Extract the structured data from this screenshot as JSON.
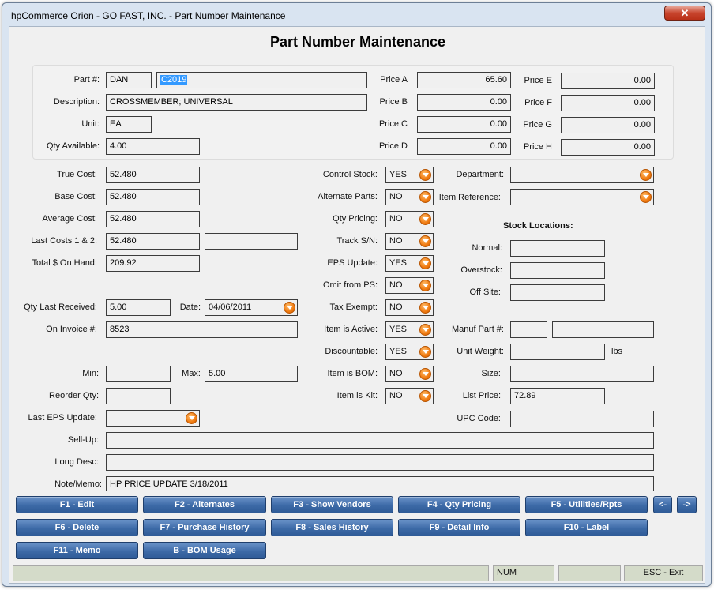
{
  "window": {
    "title": "hpCommerce Orion - GO FAST, INC. - Part Number Maintenance",
    "close_glyph": "✕"
  },
  "form": {
    "title": "Part Number Maintenance"
  },
  "header": {
    "part_label": "Part #:",
    "part_prefix": "DAN",
    "part_number": "C2019",
    "description_label": "Description:",
    "description": "CROSSMEMBER; UNIVERSAL",
    "unit_label": "Unit:",
    "unit": "EA",
    "qty_available_label": "Qty Available:",
    "qty_available": "4.00",
    "prices": [
      {
        "label": "Price A",
        "value": "65.60"
      },
      {
        "label": "Price B",
        "value": "0.00"
      },
      {
        "label": "Price C",
        "value": "0.00"
      },
      {
        "label": "Price D",
        "value": "0.00"
      },
      {
        "label": "Price E",
        "value": "0.00"
      },
      {
        "label": "Price F",
        "value": "0.00"
      },
      {
        "label": "Price G",
        "value": "0.00"
      },
      {
        "label": "Price H",
        "value": "0.00"
      }
    ]
  },
  "costs": {
    "true_cost_label": "True Cost:",
    "true_cost": "52.480",
    "base_cost_label": "Base Cost:",
    "base_cost": "52.480",
    "average_cost_label": "Average Cost:",
    "average_cost": "52.480",
    "last_costs_label": "Last Costs 1 & 2:",
    "last_cost_1": "52.480",
    "last_cost_2": "",
    "total_on_hand_label": "Total $ On Hand:",
    "total_on_hand": "209.92",
    "qty_last_received_label": "Qty Last Received:",
    "qty_last_received": "5.00",
    "date_label": "Date:",
    "date": "04/06/2011",
    "on_invoice_label": "On Invoice #:",
    "on_invoice": "8523",
    "min_label": "Min:",
    "min": "",
    "max_label": "Max:",
    "max": "5.00",
    "reorder_qty_label": "Reorder Qty:",
    "reorder_qty": "",
    "last_eps_update_label": "Last EPS Update:",
    "last_eps_update": ""
  },
  "flags": [
    {
      "label": "Control Stock:",
      "value": "YES"
    },
    {
      "label": "Alternate Parts:",
      "value": "NO"
    },
    {
      "label": "Qty Pricing:",
      "value": "NO"
    },
    {
      "label": "Track S/N:",
      "value": "NO"
    },
    {
      "label": "EPS Update:",
      "value": "YES"
    },
    {
      "label": "Omit from PS:",
      "value": "NO"
    },
    {
      "label": "Tax Exempt:",
      "value": "NO"
    },
    {
      "label": "Item is Active:",
      "value": "YES"
    },
    {
      "label": "Discountable:",
      "value": "YES"
    },
    {
      "label": "Item is BOM:",
      "value": "NO"
    },
    {
      "label": "Item is Kit:",
      "value": "NO"
    }
  ],
  "right": {
    "department_label": "Department:",
    "department": "",
    "item_reference_label": "Item Reference:",
    "item_reference": "",
    "stock_locations_heading": "Stock Locations:",
    "normal_label": "Normal:",
    "normal": "",
    "overstock_label": "Overstock:",
    "overstock": "",
    "off_site_label": "Off Site:",
    "off_site": "",
    "manuf_part_label": "Manuf Part #:",
    "manuf_part_1": "",
    "manuf_part_2": "",
    "unit_weight_label": "Unit Weight:",
    "unit_weight": "",
    "unit_weight_unit": "lbs",
    "size_label": "Size:",
    "size": "",
    "list_price_label": "List Price:",
    "list_price": "72.89",
    "upc_code_label": "UPC Code:",
    "upc_code": ""
  },
  "bottom": {
    "sell_up_label": "Sell-Up:",
    "sell_up": "",
    "long_desc_label": "Long Desc:",
    "long_desc": "",
    "note_memo_label": "Note/Memo:",
    "note_memo": "HP PRICE UPDATE 3/18/2011"
  },
  "buttons": {
    "f1": "F1 - Edit",
    "f2": "F2 - Alternates",
    "f3": "F3 - Show Vendors",
    "f4": "F4 - Qty Pricing",
    "f5": "F5 - Utilities/Rpts",
    "prev": "<-",
    "next": "->",
    "f6": "F6 - Delete",
    "f7": "F7 - Purchase History",
    "f8": "F8 - Sales History",
    "f9": "F9 - Detail Info",
    "f10": "F10 - Label",
    "f11": "F11 - Memo",
    "bom": "B - BOM Usage"
  },
  "statusbar": {
    "num": "NUM",
    "esc": "ESC - Exit"
  }
}
